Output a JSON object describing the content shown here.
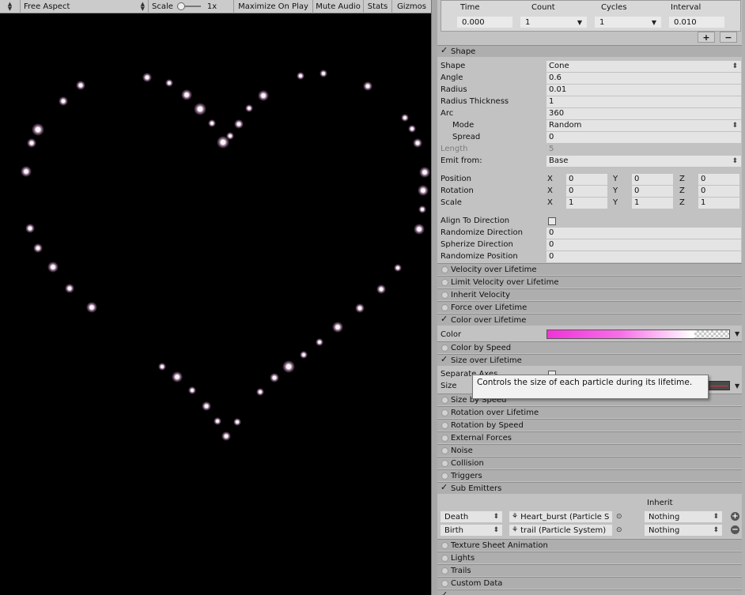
{
  "toolbar": {
    "aspect": "Free Aspect",
    "scale_label": "Scale",
    "scale_value": "1x",
    "maximize": "Maximize On Play",
    "mute": "Mute Audio",
    "stats": "Stats",
    "gizmos": "Gizmos"
  },
  "emission_bursts": {
    "headers": [
      "Time",
      "Count",
      "Cycles",
      "Interval"
    ],
    "row": {
      "time": "0.000",
      "count": "1",
      "cycles": "1",
      "interval": "0.010"
    },
    "add": "+",
    "remove": "−"
  },
  "shape_module": {
    "title": "Shape",
    "shape": {
      "label": "Shape",
      "value": "Cone"
    },
    "angle": {
      "label": "Angle",
      "value": "0.6"
    },
    "radius": {
      "label": "Radius",
      "value": "0.01"
    },
    "radius_thickness": {
      "label": "Radius Thickness",
      "value": "1"
    },
    "arc": {
      "label": "Arc",
      "value": "360"
    },
    "mode": {
      "label": "Mode",
      "value": "Random"
    },
    "spread": {
      "label": "Spread",
      "value": "0"
    },
    "length": {
      "label": "Length",
      "value": "5"
    },
    "emit_from": {
      "label": "Emit from:",
      "value": "Base"
    },
    "position": {
      "label": "Position",
      "x": "0",
      "y": "0",
      "z": "0"
    },
    "rotation": {
      "label": "Rotation",
      "x": "0",
      "y": "0",
      "z": "0"
    },
    "scale": {
      "label": "Scale",
      "x": "1",
      "y": "1",
      "z": "1"
    },
    "axis": {
      "x": "X",
      "y": "Y",
      "z": "Z"
    },
    "align_to_direction": {
      "label": "Align To Direction"
    },
    "randomize_direction": {
      "label": "Randomize Direction",
      "value": "0"
    },
    "spherize_direction": {
      "label": "Spherize Direction",
      "value": "0"
    },
    "randomize_position": {
      "label": "Randomize Position",
      "value": "0"
    }
  },
  "modules": {
    "velocity_over_lifetime": "Velocity over Lifetime",
    "limit_velocity": "Limit Velocity over Lifetime",
    "inherit_velocity": "Inherit Velocity",
    "force_over_lifetime": "Force over Lifetime",
    "color_over_lifetime": "Color over Lifetime",
    "color_by_speed": "Color by Speed",
    "size_over_lifetime": "Size over Lifetime",
    "size_by_speed": "Size by Speed",
    "rotation_over_lifetime": "Rotation over Lifetime",
    "rotation_by_speed": "Rotation by Speed",
    "external_forces": "External Forces",
    "noise": "Noise",
    "collision": "Collision",
    "triggers": "Triggers",
    "sub_emitters": "Sub Emitters",
    "texture_sheet": "Texture Sheet Animation",
    "lights": "Lights",
    "trails": "Trails",
    "custom_data": "Custom Data"
  },
  "color_over_lifetime": {
    "color_label": "Color"
  },
  "size_over_lifetime": {
    "separate_axes": "Separate Axes",
    "size_label": "Size"
  },
  "tooltip": {
    "text": "Controls the size of each particle during its lifetime."
  },
  "sub_emitters": {
    "inherit_header": "Inherit",
    "rows": [
      {
        "event": "Death",
        "system": "Heart_burst (Particle S",
        "inherit": "Nothing"
      },
      {
        "event": "Birth",
        "system": "trail (Particle System)",
        "inherit": "Nothing"
      }
    ]
  },
  "colors": {
    "gradient_start": "#f032d8",
    "gradient_end": "#ffffff",
    "particle_core": "#ffffff",
    "particle_glow": "#f4b6ee"
  }
}
